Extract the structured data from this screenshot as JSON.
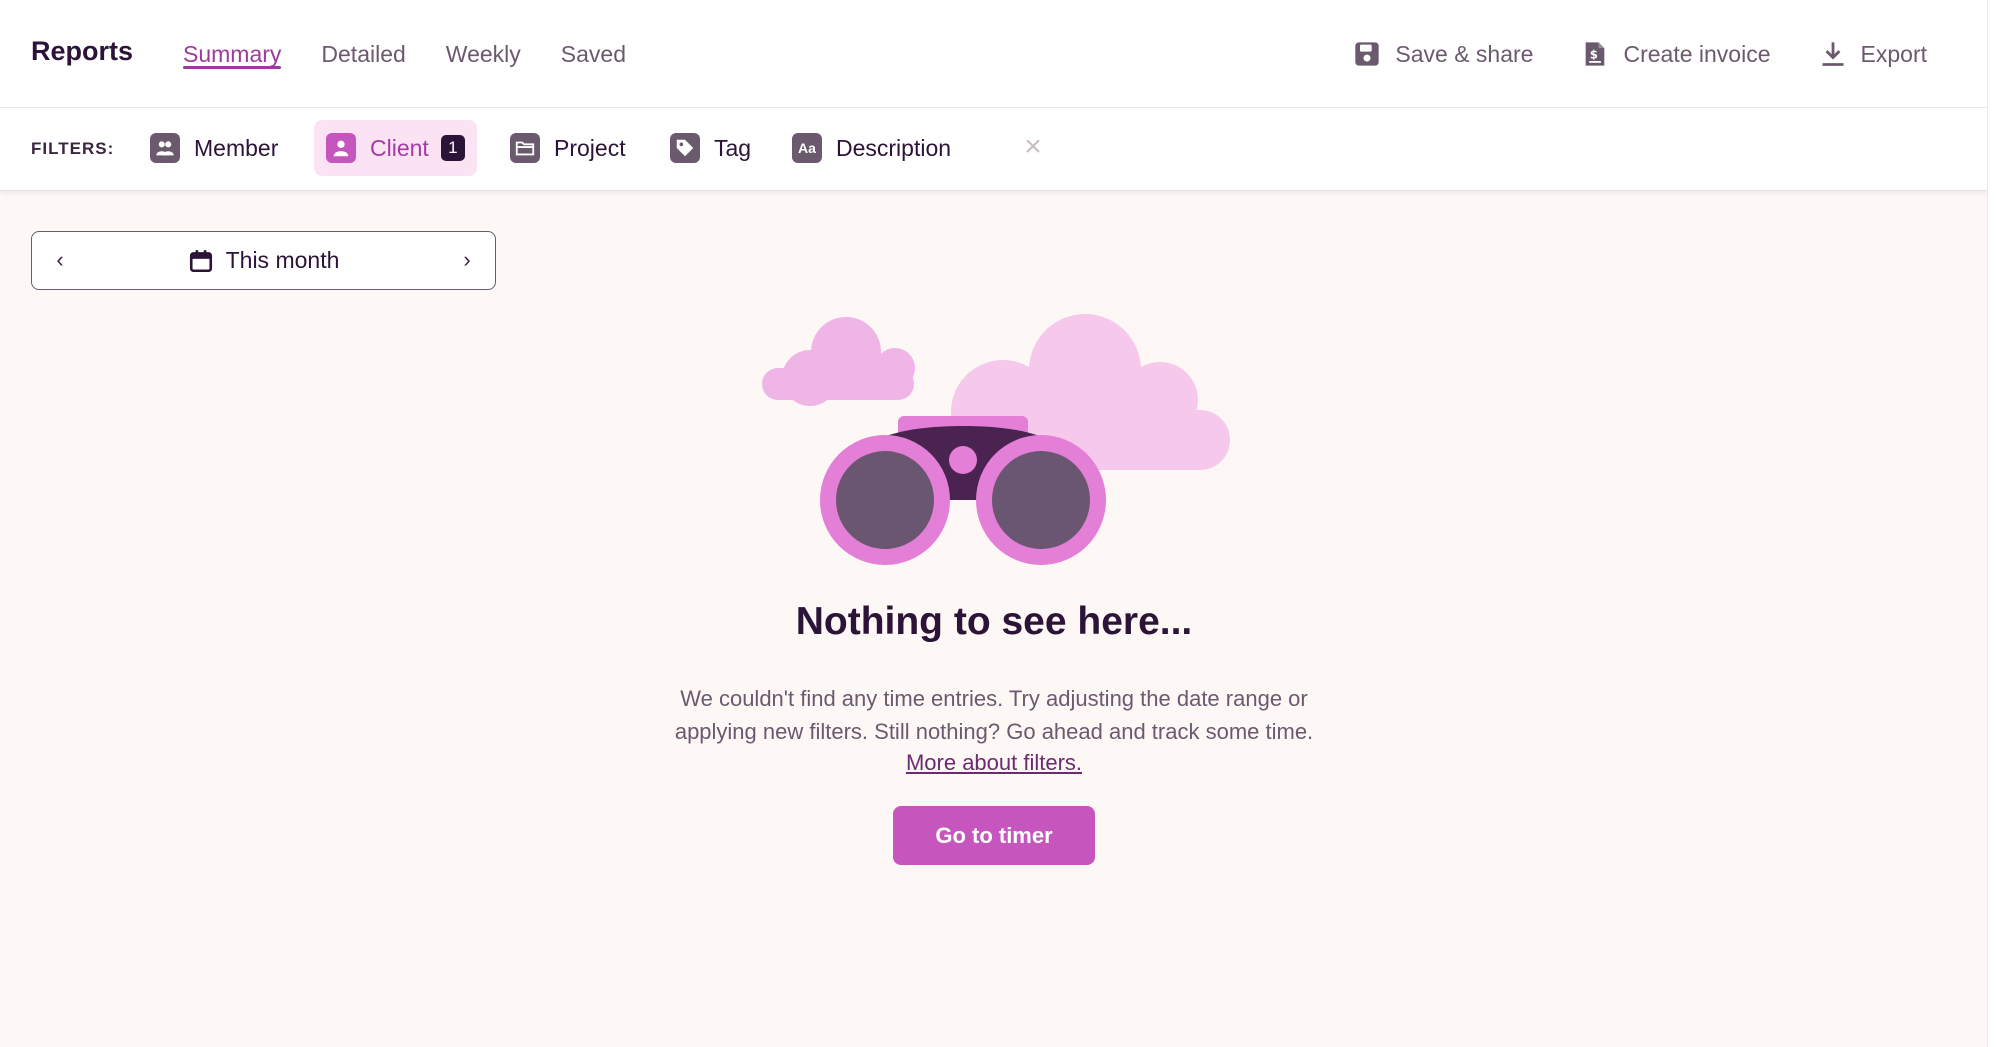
{
  "header": {
    "title": "Reports",
    "tabs": [
      {
        "label": "Summary",
        "active": true
      },
      {
        "label": "Detailed",
        "active": false
      },
      {
        "label": "Weekly",
        "active": false
      },
      {
        "label": "Saved",
        "active": false
      }
    ],
    "actions": [
      {
        "label": "Save & share",
        "icon": "save-icon"
      },
      {
        "label": "Create invoice",
        "icon": "invoice-icon"
      },
      {
        "label": "Export",
        "icon": "download-icon"
      }
    ]
  },
  "filters": {
    "label": "FILTERS:",
    "items": [
      {
        "label": "Member",
        "icon": "members-icon",
        "active": false
      },
      {
        "label": "Client",
        "icon": "client-icon",
        "active": true,
        "count": "1"
      },
      {
        "label": "Project",
        "icon": "folder-icon",
        "active": false
      },
      {
        "label": "Tag",
        "icon": "tag-icon",
        "active": false
      },
      {
        "label": "Description",
        "icon": "description-icon",
        "active": false,
        "icon_text": "Aa"
      }
    ],
    "clear_symbol": "×"
  },
  "date_range": {
    "label": "This month",
    "prev_symbol": "‹",
    "next_symbol": "›"
  },
  "empty_state": {
    "title": "Nothing to see here...",
    "text_line1": "We couldn't find any time entries. Try adjusting the date range or",
    "text_line2": "applying new filters. Still nothing? Go ahead and track some time.",
    "link": "More about filters.",
    "button": "Go to timer"
  },
  "colors": {
    "accent": "#c656bd",
    "active_tab": "#9e3a9d",
    "dark": "#2c1338",
    "muted": "#6b5a6e",
    "background": "#fdf7f5"
  }
}
